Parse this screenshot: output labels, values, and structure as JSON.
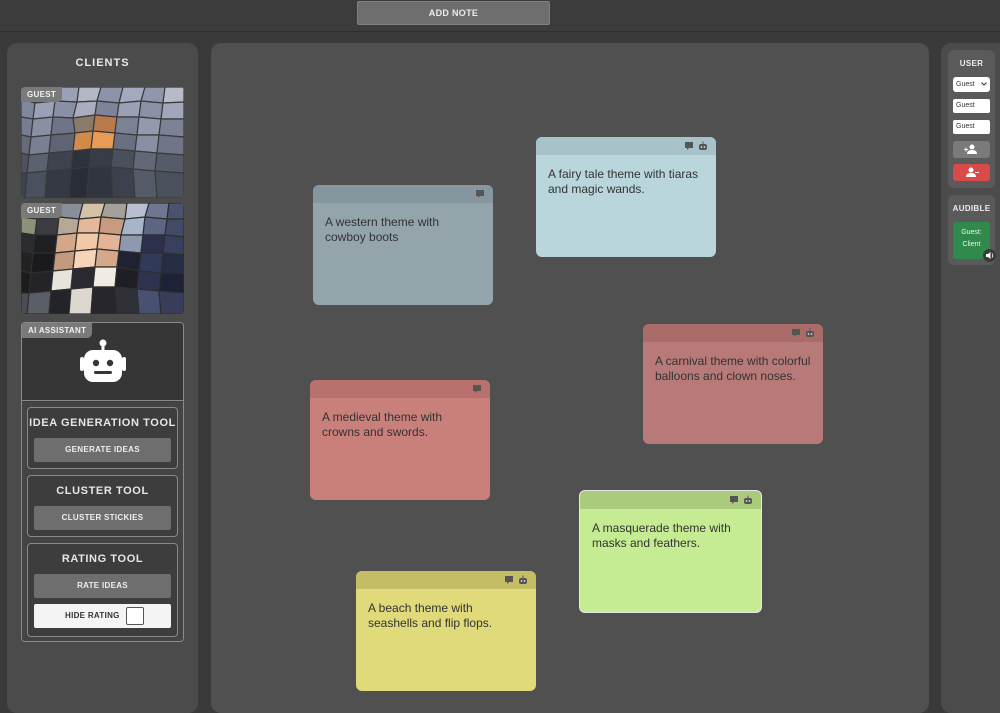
{
  "toolbar": {
    "add_note_label": "ADD NOTE"
  },
  "clients": {
    "title": "CLIENTS",
    "videos": [
      {
        "tag": "GUEST"
      },
      {
        "tag": "GUEST"
      }
    ]
  },
  "ai_assistant": {
    "tag": "AI ASSISTANT",
    "icon": "robot-icon",
    "tools": {
      "idea": {
        "title": "IDEA GENERATION TOOL",
        "button": "GENERATE IDEAS"
      },
      "cluster": {
        "title": "CLUSTER TOOL",
        "button": "CLUSTER STICKIES"
      },
      "rating": {
        "title": "RATING TOOL",
        "button": "RATE IDEAS",
        "hide_label": "HIDE RATING",
        "hide_checked": false
      }
    }
  },
  "notes": [
    {
      "text": "A western theme with cowboy boots",
      "color": "#93a4ab",
      "bar_color": "#8596a0"
    },
    {
      "text": "A fairy tale theme with tiaras and magic wands.",
      "color": "#b9d6dc",
      "bar_color": "#a7c2c9"
    },
    {
      "text": "A carnival theme with colorful balloons and clown noses.",
      "color": "#b87a78",
      "bar_color": "#a96c69"
    },
    {
      "text": "A medieval theme with crowns and swords.",
      "color": "#c97f7a",
      "bar_color": "#b8716c"
    },
    {
      "text": "A masquerade theme with masks and feathers.",
      "color": "#c5ec92",
      "bar_color": "#a9cb7b"
    },
    {
      "text": "A beach theme with seashells and flip flops.",
      "color": "#e0da7a",
      "bar_color": "#c4bd66"
    }
  ],
  "user_panel": {
    "title": "USER",
    "select_value": "Guest",
    "field1": "Guest",
    "field2": "Guest",
    "add_user_color": "#7a7a7a",
    "remove_user_color": "#d94a4a"
  },
  "audible": {
    "title": "AUDIBLE",
    "card_label": "Guest: Client",
    "card_color": "#2f8a4b"
  }
}
